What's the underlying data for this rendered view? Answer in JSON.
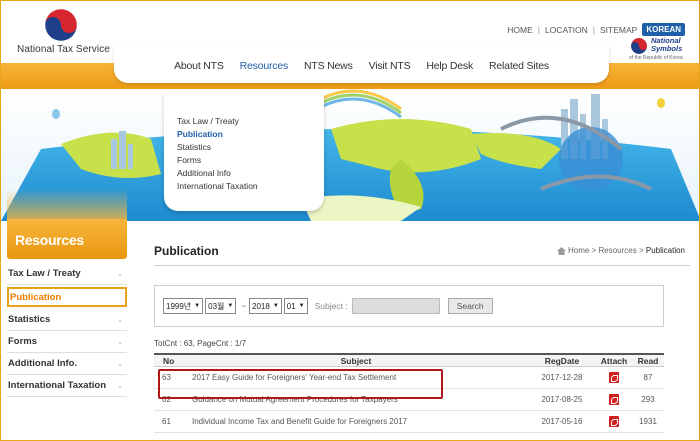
{
  "header": {
    "logo_text": "National Tax Service",
    "util_links": [
      "HOME",
      "LOCATION",
      "SITEMAP"
    ],
    "lang_button": "KOREAN",
    "symbols_line1": "National",
    "symbols_line2": "Symbols",
    "symbols_sub": "of the Republic of Korea"
  },
  "gnb": {
    "items": [
      "About NTS",
      "Resources",
      "NTS News",
      "Visit NTS",
      "Help Desk",
      "Related Sites"
    ],
    "active": "Resources"
  },
  "submenu": {
    "items": [
      "Tax Law / Treaty",
      "Publication",
      "Statistics",
      "Forms",
      "Additional Info",
      "International Taxation"
    ],
    "active": "Publication"
  },
  "sidebar": {
    "title": "Resources",
    "items": [
      "Tax Law / Treaty",
      "Publication",
      "Statistics",
      "Forms",
      "Additional Info.",
      "International Taxation"
    ],
    "active": "Publication"
  },
  "content": {
    "title": "Publication",
    "breadcrumb": [
      "Home",
      "Resources",
      "Publication"
    ]
  },
  "search": {
    "from_year": "1999년",
    "from_month": "03월",
    "tilde": "~",
    "to_year": "2018",
    "to_month": "01",
    "subject_label": "Subject :",
    "subject_value": "",
    "button": "Search"
  },
  "list": {
    "summary": "TotCnt : 63, PageCnt : 1/7",
    "headers": [
      "No",
      "Subject",
      "RegDate",
      "Attach",
      "Read"
    ],
    "rows": [
      {
        "no": "63",
        "subject": "2017 Easy Guide for Foreigners' Year-end Tax Settlement",
        "date": "2017-12-28",
        "read": "87"
      },
      {
        "no": "62",
        "subject": "Guidance on Mutual Agreement Procedures for Taxpayers",
        "date": "2017-08-25",
        "read": "293"
      },
      {
        "no": "61",
        "subject": "Individual Income Tax and Benefit Guide for Foreigners 2017",
        "date": "2017-05-16",
        "read": "1931"
      }
    ]
  },
  "colors": {
    "orange": "#ee9b14",
    "link_blue": "#1f5ea8",
    "highlight": "#b01818"
  }
}
